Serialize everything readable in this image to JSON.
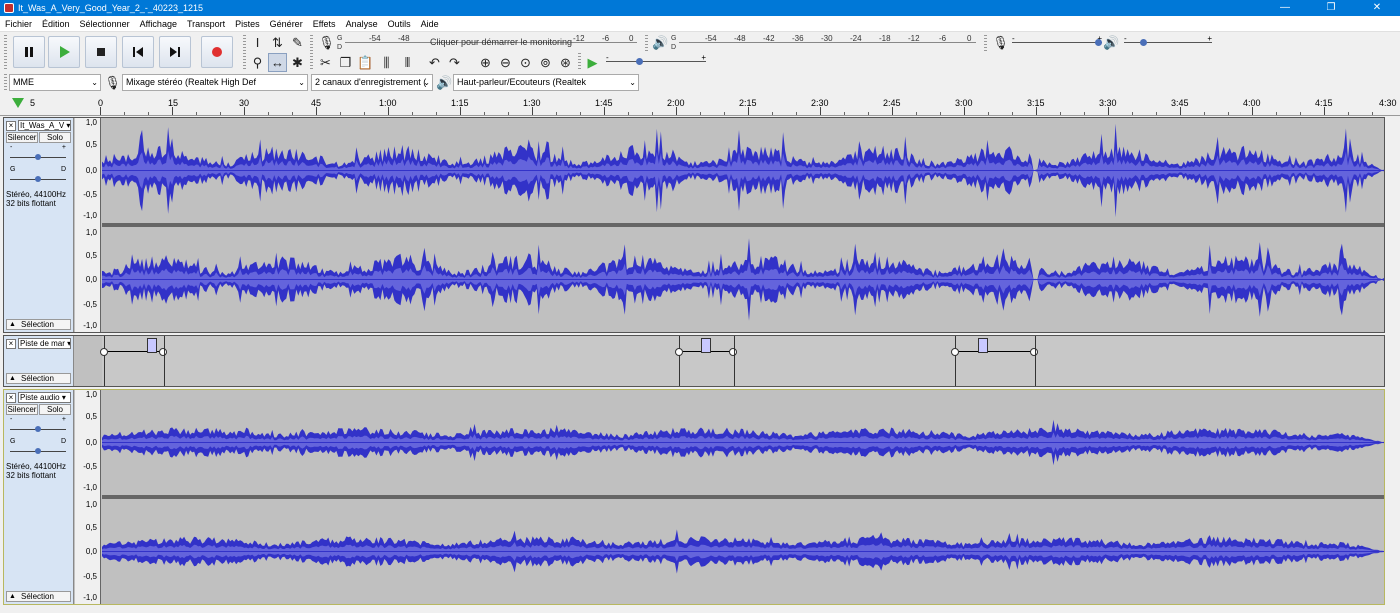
{
  "window": {
    "title": "It_Was_A_Very_Good_Year_2_-_40223_1215",
    "minimize": "—",
    "maximize": "❐",
    "close": "✕"
  },
  "menu": [
    "Fichier",
    "Édition",
    "Sélectionner",
    "Affichage",
    "Transport",
    "Pistes",
    "Générer",
    "Effets",
    "Analyse",
    "Outils",
    "Aide"
  ],
  "transport": {
    "pause": "pause-icon",
    "play": "play-icon",
    "stop": "stop-icon",
    "skip_start": "skip-start-icon",
    "skip_end": "skip-end-icon",
    "record": "record-icon"
  },
  "record_meter": {
    "lr_top": "G",
    "lr_bottom": "D",
    "ticks": [
      "-54",
      "-48",
      "-12",
      "-6",
      "0"
    ],
    "prompt": "Cliquer pour démarrer le monitoring"
  },
  "playback_meter": {
    "lr_top": "G",
    "lr_bottom": "D",
    "ticks": [
      "-54",
      "-48",
      "-42",
      "-36",
      "-30",
      "-24",
      "-18",
      "-12",
      "-6",
      "0"
    ]
  },
  "mixer": {
    "rec_minus": "-",
    "rec_plus": "+",
    "play_minus": "-",
    "play_plus": "+"
  },
  "play_at_speed": {
    "minus": "-",
    "plus": "+"
  },
  "device": {
    "host": "MME",
    "input": "Mixage stéréo (Realtek High Def",
    "channels": "2 canaux d'enregistrement (",
    "output": "Haut-parleur/Ecouteurs (Realtek"
  },
  "timeline": {
    "ticks": [
      "5",
      "0",
      "15",
      "30",
      "45",
      "1:00",
      "1:15",
      "1:30",
      "1:45",
      "2:00",
      "2:15",
      "2:30",
      "2:45",
      "3:00",
      "3:15",
      "3:30",
      "3:45",
      "4:00",
      "4:15",
      "4:30"
    ]
  },
  "tracks": [
    {
      "name": "It_Was_A_V",
      "mute": "Silencer",
      "solo": "Solo",
      "gain_minus": "-",
      "gain_plus": "+",
      "pan_left": "G",
      "pan_right": "D",
      "info1": "Stéréo, 44100Hz",
      "info2": "32 bits flottant",
      "select": "Sélection",
      "scale": [
        "1,0",
        "0,5",
        "0,0",
        "-0,5",
        "-1,0"
      ]
    },
    {
      "name": "Piste de mar",
      "select": "Sélection"
    },
    {
      "name": "Piste audio",
      "mute": "Silencer",
      "solo": "Solo",
      "gain_minus": "-",
      "gain_plus": "+",
      "pan_left": "G",
      "pan_right": "D",
      "info1": "Stéréo, 44100Hz",
      "info2": "32 bits flottant",
      "select": "Sélection",
      "scale": [
        "1,0",
        "0,5",
        "0,0",
        "-0,5",
        "-1,0"
      ]
    }
  ],
  "colors": {
    "titlebar": "#0078d7",
    "waveform": "#3232c8",
    "waveform_rms": "#6464dc",
    "track_bg": "#c0c0c0",
    "record_button": "#e03030",
    "play_button": "#3cae3c"
  }
}
